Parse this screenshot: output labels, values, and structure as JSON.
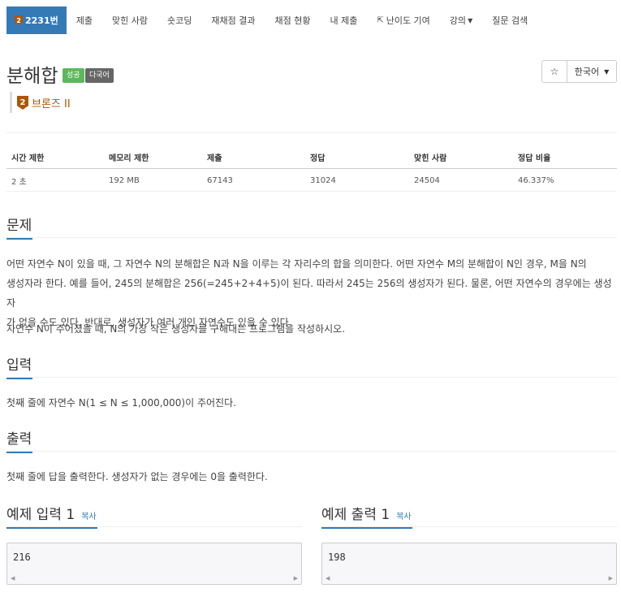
{
  "nav": {
    "problem_number": "2231번",
    "tier_mini": "2",
    "items": [
      "제출",
      "맞힌 사람",
      "숏코딩",
      "재채점 결과",
      "채점 현황",
      "내 제출",
      "난이도 기여",
      "강의",
      "질문 검색"
    ]
  },
  "problem": {
    "title": "분해합",
    "label_success": "성공",
    "label_multilang": "다국어",
    "star": "☆",
    "language": "한국어",
    "tier_number": "2",
    "tier_text": "브론즈 II"
  },
  "info": {
    "headers": [
      "시간 제한",
      "메모리 제한",
      "제출",
      "정답",
      "맞힌 사람",
      "정답 비율"
    ],
    "values": [
      "2 초",
      "192 MB",
      "67143",
      "31024",
      "24504",
      "46.337%"
    ]
  },
  "sections": {
    "description_title": "문제",
    "description_lines": [
      "어떤 자연수 N이 있을 때, 그 자연수 N의 분해합은 N과 N을 이루는 각 자리수의 합을 의미한다. 어떤 자연수 M의 분해합이 N인 경우, M을 N의",
      "생성자라 한다. 예를 들어, 245의 분해합은 256(=245+2+4+5)이 된다. 따라서 245는 256의 생성자가 된다. 물론, 어떤 자연수의 경우에는 생성자",
      "가 없을 수도 있다. 반대로, 생성자가 여러 개인 자연수도 있을 수 있다."
    ],
    "description_line4": "자연수 N이 주어졌을 때, N의 가장 작은 생성자를 구해내는 프로그램을 작성하시오.",
    "input_title": "입력",
    "input_text": "첫째 줄에 자연수 N(1 ≤ N ≤ 1,000,000)이 주어진다.",
    "output_title": "출력",
    "output_text": "첫째 줄에 답을 출력한다. 생성자가 없는 경우에는 0을 출력한다."
  },
  "samples": {
    "input_title": "예제 입력 1",
    "output_title": "예제 출력 1",
    "copy_label": "복사",
    "input_value": "216",
    "output_value": "198"
  }
}
